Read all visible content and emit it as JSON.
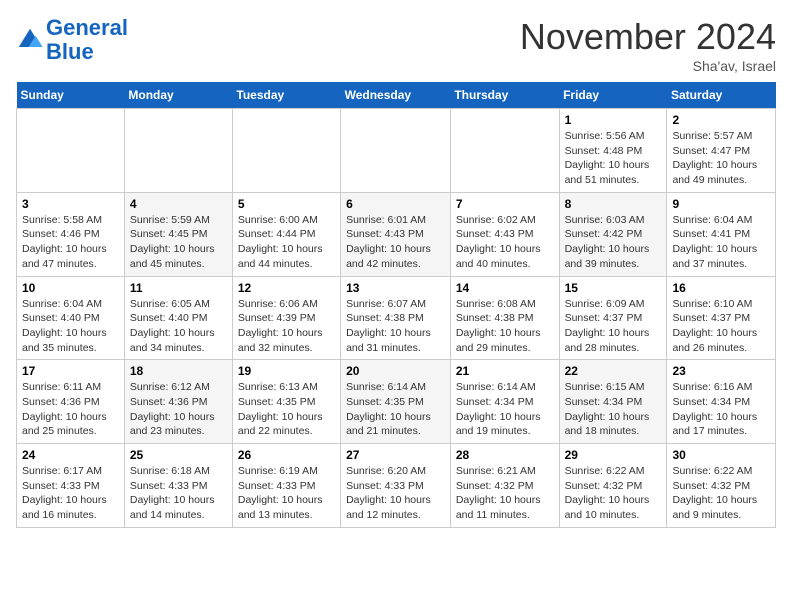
{
  "logo": {
    "line1": "General",
    "line2": "Blue"
  },
  "header": {
    "month": "November 2024",
    "location": "Sha'av, Israel"
  },
  "weekdays": [
    "Sunday",
    "Monday",
    "Tuesday",
    "Wednesday",
    "Thursday",
    "Friday",
    "Saturday"
  ],
  "weeks": [
    [
      {
        "day": "",
        "info": ""
      },
      {
        "day": "",
        "info": ""
      },
      {
        "day": "",
        "info": ""
      },
      {
        "day": "",
        "info": ""
      },
      {
        "day": "",
        "info": ""
      },
      {
        "day": "1",
        "info": "Sunrise: 5:56 AM\nSunset: 4:48 PM\nDaylight: 10 hours\nand 51 minutes."
      },
      {
        "day": "2",
        "info": "Sunrise: 5:57 AM\nSunset: 4:47 PM\nDaylight: 10 hours\nand 49 minutes."
      }
    ],
    [
      {
        "day": "3",
        "info": "Sunrise: 5:58 AM\nSunset: 4:46 PM\nDaylight: 10 hours\nand 47 minutes."
      },
      {
        "day": "4",
        "info": "Sunrise: 5:59 AM\nSunset: 4:45 PM\nDaylight: 10 hours\nand 45 minutes."
      },
      {
        "day": "5",
        "info": "Sunrise: 6:00 AM\nSunset: 4:44 PM\nDaylight: 10 hours\nand 44 minutes."
      },
      {
        "day": "6",
        "info": "Sunrise: 6:01 AM\nSunset: 4:43 PM\nDaylight: 10 hours\nand 42 minutes."
      },
      {
        "day": "7",
        "info": "Sunrise: 6:02 AM\nSunset: 4:43 PM\nDaylight: 10 hours\nand 40 minutes."
      },
      {
        "day": "8",
        "info": "Sunrise: 6:03 AM\nSunset: 4:42 PM\nDaylight: 10 hours\nand 39 minutes."
      },
      {
        "day": "9",
        "info": "Sunrise: 6:04 AM\nSunset: 4:41 PM\nDaylight: 10 hours\nand 37 minutes."
      }
    ],
    [
      {
        "day": "10",
        "info": "Sunrise: 6:04 AM\nSunset: 4:40 PM\nDaylight: 10 hours\nand 35 minutes."
      },
      {
        "day": "11",
        "info": "Sunrise: 6:05 AM\nSunset: 4:40 PM\nDaylight: 10 hours\nand 34 minutes."
      },
      {
        "day": "12",
        "info": "Sunrise: 6:06 AM\nSunset: 4:39 PM\nDaylight: 10 hours\nand 32 minutes."
      },
      {
        "day": "13",
        "info": "Sunrise: 6:07 AM\nSunset: 4:38 PM\nDaylight: 10 hours\nand 31 minutes."
      },
      {
        "day": "14",
        "info": "Sunrise: 6:08 AM\nSunset: 4:38 PM\nDaylight: 10 hours\nand 29 minutes."
      },
      {
        "day": "15",
        "info": "Sunrise: 6:09 AM\nSunset: 4:37 PM\nDaylight: 10 hours\nand 28 minutes."
      },
      {
        "day": "16",
        "info": "Sunrise: 6:10 AM\nSunset: 4:37 PM\nDaylight: 10 hours\nand 26 minutes."
      }
    ],
    [
      {
        "day": "17",
        "info": "Sunrise: 6:11 AM\nSunset: 4:36 PM\nDaylight: 10 hours\nand 25 minutes."
      },
      {
        "day": "18",
        "info": "Sunrise: 6:12 AM\nSunset: 4:36 PM\nDaylight: 10 hours\nand 23 minutes."
      },
      {
        "day": "19",
        "info": "Sunrise: 6:13 AM\nSunset: 4:35 PM\nDaylight: 10 hours\nand 22 minutes."
      },
      {
        "day": "20",
        "info": "Sunrise: 6:14 AM\nSunset: 4:35 PM\nDaylight: 10 hours\nand 21 minutes."
      },
      {
        "day": "21",
        "info": "Sunrise: 6:14 AM\nSunset: 4:34 PM\nDaylight: 10 hours\nand 19 minutes."
      },
      {
        "day": "22",
        "info": "Sunrise: 6:15 AM\nSunset: 4:34 PM\nDaylight: 10 hours\nand 18 minutes."
      },
      {
        "day": "23",
        "info": "Sunrise: 6:16 AM\nSunset: 4:34 PM\nDaylight: 10 hours\nand 17 minutes."
      }
    ],
    [
      {
        "day": "24",
        "info": "Sunrise: 6:17 AM\nSunset: 4:33 PM\nDaylight: 10 hours\nand 16 minutes."
      },
      {
        "day": "25",
        "info": "Sunrise: 6:18 AM\nSunset: 4:33 PM\nDaylight: 10 hours\nand 14 minutes."
      },
      {
        "day": "26",
        "info": "Sunrise: 6:19 AM\nSunset: 4:33 PM\nDaylight: 10 hours\nand 13 minutes."
      },
      {
        "day": "27",
        "info": "Sunrise: 6:20 AM\nSunset: 4:33 PM\nDaylight: 10 hours\nand 12 minutes."
      },
      {
        "day": "28",
        "info": "Sunrise: 6:21 AM\nSunset: 4:32 PM\nDaylight: 10 hours\nand 11 minutes."
      },
      {
        "day": "29",
        "info": "Sunrise: 6:22 AM\nSunset: 4:32 PM\nDaylight: 10 hours\nand 10 minutes."
      },
      {
        "day": "30",
        "info": "Sunrise: 6:22 AM\nSunset: 4:32 PM\nDaylight: 10 hours\nand 9 minutes."
      }
    ]
  ]
}
